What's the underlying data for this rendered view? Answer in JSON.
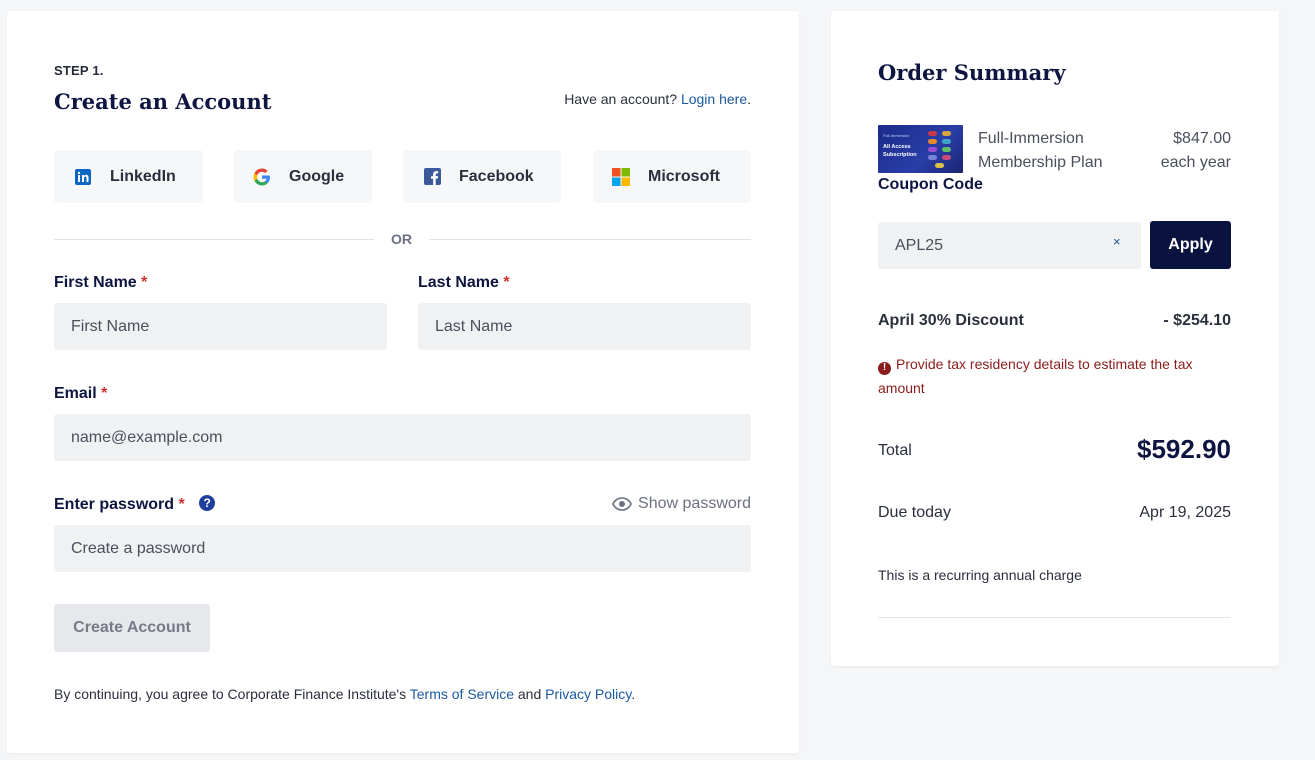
{
  "account": {
    "step": "STEP 1.",
    "title": "Create an Account",
    "have_account": "Have an account?",
    "login_link": "Login here",
    "login_punct": ".",
    "social": [
      {
        "label": "LinkedIn",
        "icon": "linkedin-icon"
      },
      {
        "label": "Google",
        "icon": "google-icon"
      },
      {
        "label": "Facebook",
        "icon": "facebook-icon"
      },
      {
        "label": "Microsoft",
        "icon": "microsoft-icon"
      }
    ],
    "or": "OR",
    "first_name": {
      "label": "First Name",
      "placeholder": "First Name"
    },
    "last_name": {
      "label": "Last Name",
      "placeholder": "Last Name"
    },
    "email": {
      "label": "Email",
      "placeholder": "name@example.com"
    },
    "password": {
      "label": "Enter password",
      "placeholder": "Create a password",
      "show": "Show password"
    },
    "required_mark": "*",
    "help": "?",
    "create_button": "Create Account",
    "terms_prefix": "By continuing, you agree to Corporate Finance Institute's",
    "terms_link": "Terms of Service",
    "terms_and": "and",
    "privacy_link": "Privacy Policy",
    "terms_end": "."
  },
  "summary": {
    "title": "Order Summary",
    "product": {
      "name_line1": "Full-Immersion",
      "name_line2": "Membership Plan",
      "price": "$847.00",
      "period": "each year",
      "thumb_small": "Full-Immersion",
      "thumb_line1": "All Access",
      "thumb_line2": "Subscription"
    },
    "coupon_label": "Coupon Code",
    "coupon_value": "APL25",
    "clear": "×",
    "apply": "Apply",
    "discount_label": "April 30% Discount",
    "discount_value": "- $254.10",
    "warning": "Provide tax residency details to estimate the tax amount",
    "warning_icon": "!",
    "total_label": "Total",
    "total_value": "$592.90",
    "due_label": "Due today",
    "due_value": "Apr 19, 2025",
    "recurring": "This is a recurring annual charge"
  },
  "colors": {
    "navy": "#0e1540",
    "link": "#1b5aa0",
    "error": "#8c1c1c",
    "required": "#d0312d"
  }
}
